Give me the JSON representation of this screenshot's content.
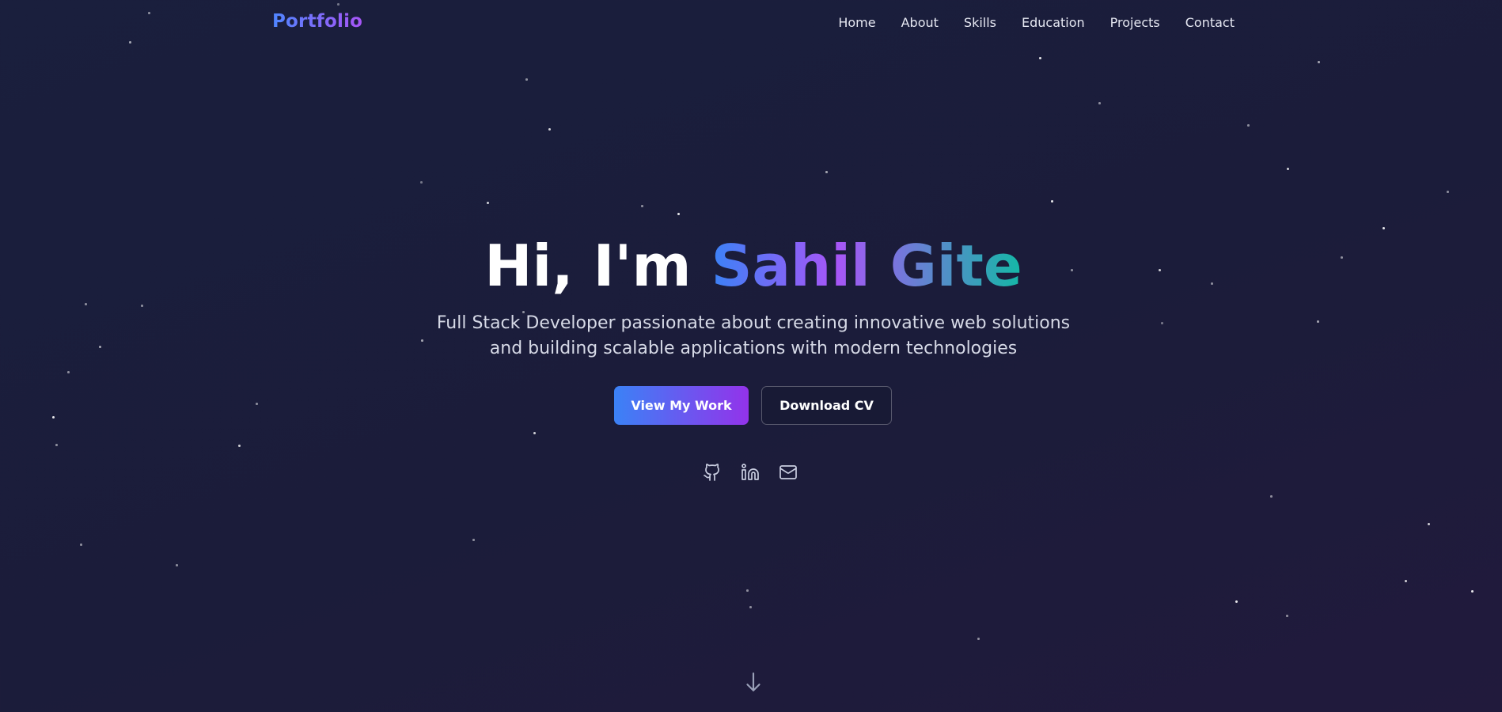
{
  "nav": {
    "logo": "Portfolio",
    "links": [
      "Home",
      "About",
      "Skills",
      "Education",
      "Projects",
      "Contact"
    ]
  },
  "hero": {
    "greeting": "Hi, I'm ",
    "name": "Sahil Gite",
    "subtitle_line1": "Full Stack Developer passionate about creating innovative web solutions",
    "subtitle_line2": "and building scalable applications with modern technologies",
    "primary_button": "View My Work",
    "secondary_button": "Download CV"
  },
  "social_icons": [
    "github-icon",
    "linkedin-icon",
    "mail-icon"
  ],
  "scroll_icon": "arrow-down-icon",
  "colors": {
    "background": "#1b1e3c",
    "accent_blue": "#3b82f6",
    "accent_purple": "#9333ea",
    "accent_teal": "#14b8a6"
  }
}
